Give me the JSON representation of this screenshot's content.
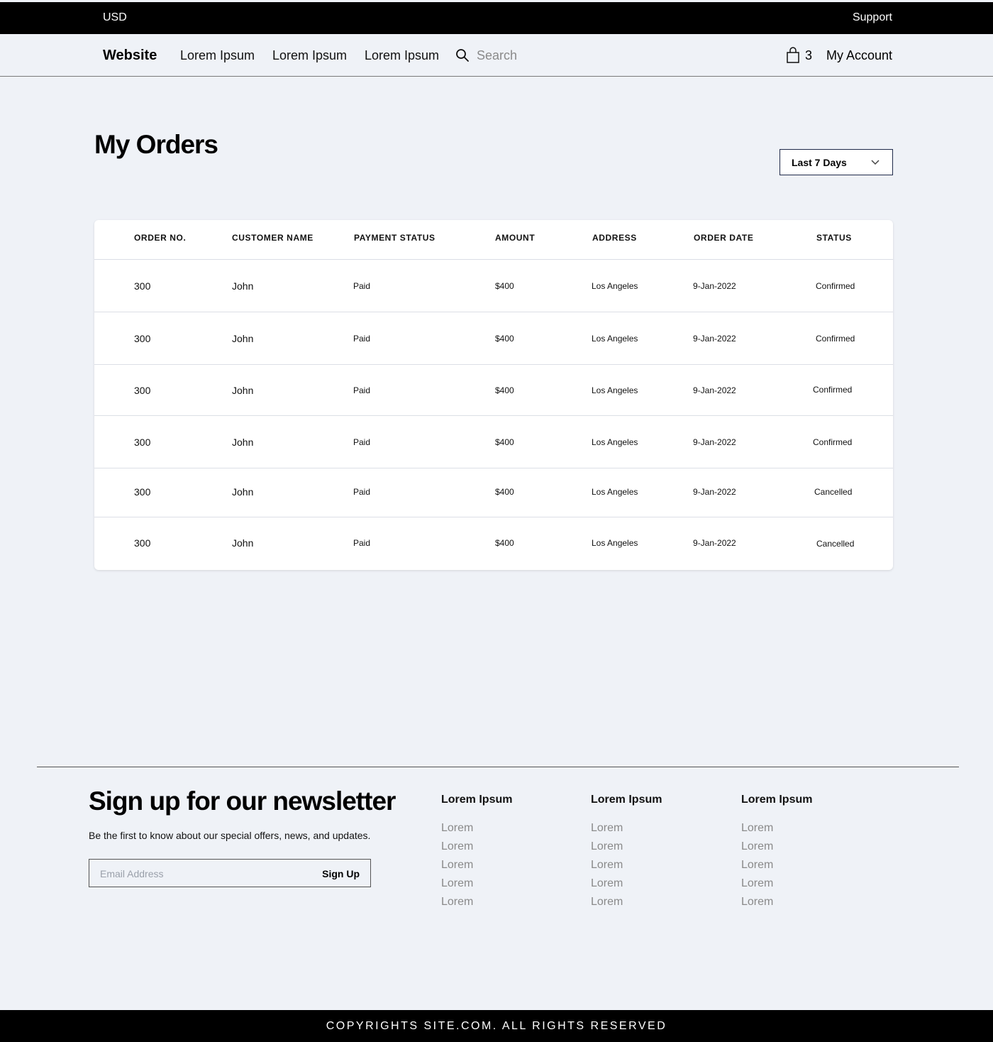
{
  "topbar": {
    "currency": "USD",
    "support": "Support"
  },
  "nav": {
    "brand": "Website",
    "links": [
      "Lorem Ipsum",
      "Lorem Ipsum",
      "Lorem Ipsum"
    ],
    "search_placeholder": "Search",
    "cart_count": "3",
    "account": "My Account"
  },
  "page": {
    "title": "My Orders",
    "filter": "Last 7 Days"
  },
  "table": {
    "headers": [
      "ORDER NO.",
      "CUSTOMER NAME",
      "PAYMENT STATUS",
      "AMOUNT",
      "ADDRESS",
      "ORDER DATE",
      "STATUS"
    ],
    "rows": [
      [
        "300",
        "John",
        "Paid",
        "$400",
        "Los Angeles",
        "9-Jan-2022",
        "Confirmed"
      ],
      [
        "300",
        "John",
        "Paid",
        "$400",
        "Los Angeles",
        "9-Jan-2022",
        "Confirmed"
      ],
      [
        "300",
        "John",
        "Paid",
        "$400",
        "Los Angeles",
        "9-Jan-2022",
        "Confirmed"
      ],
      [
        "300",
        "John",
        "Paid",
        "$400",
        "Los Angeles",
        "9-Jan-2022",
        "Confirmed"
      ],
      [
        "300",
        "John",
        "Paid",
        "$400",
        "Los Angeles",
        "9-Jan-2022",
        "Cancelled"
      ],
      [
        "300",
        "John",
        "Paid",
        "$400",
        "Los Angeles",
        "9-Jan-2022",
        "Cancelled"
      ]
    ]
  },
  "newsletter": {
    "title": "Sign up for our newsletter",
    "subtitle": "Be the first to know about our special offers, news, and updates.",
    "email_placeholder": "Email Address",
    "button": "Sign Up"
  },
  "footer_columns": [
    {
      "heading": "Lorem Ipsum",
      "items": [
        "Lorem",
        "Lorem",
        "Lorem",
        "Lorem",
        "Lorem"
      ]
    },
    {
      "heading": "Lorem Ipsum",
      "items": [
        "Lorem",
        "Lorem",
        "Lorem",
        "Lorem",
        "Lorem"
      ]
    },
    {
      "heading": "Lorem Ipsum",
      "items": [
        "Lorem",
        "Lorem",
        "Lorem",
        "Lorem",
        "Lorem"
      ]
    }
  ],
  "copyright": "COPYRIGHTS SITE.COM. ALL RIGHTS RESERVED"
}
